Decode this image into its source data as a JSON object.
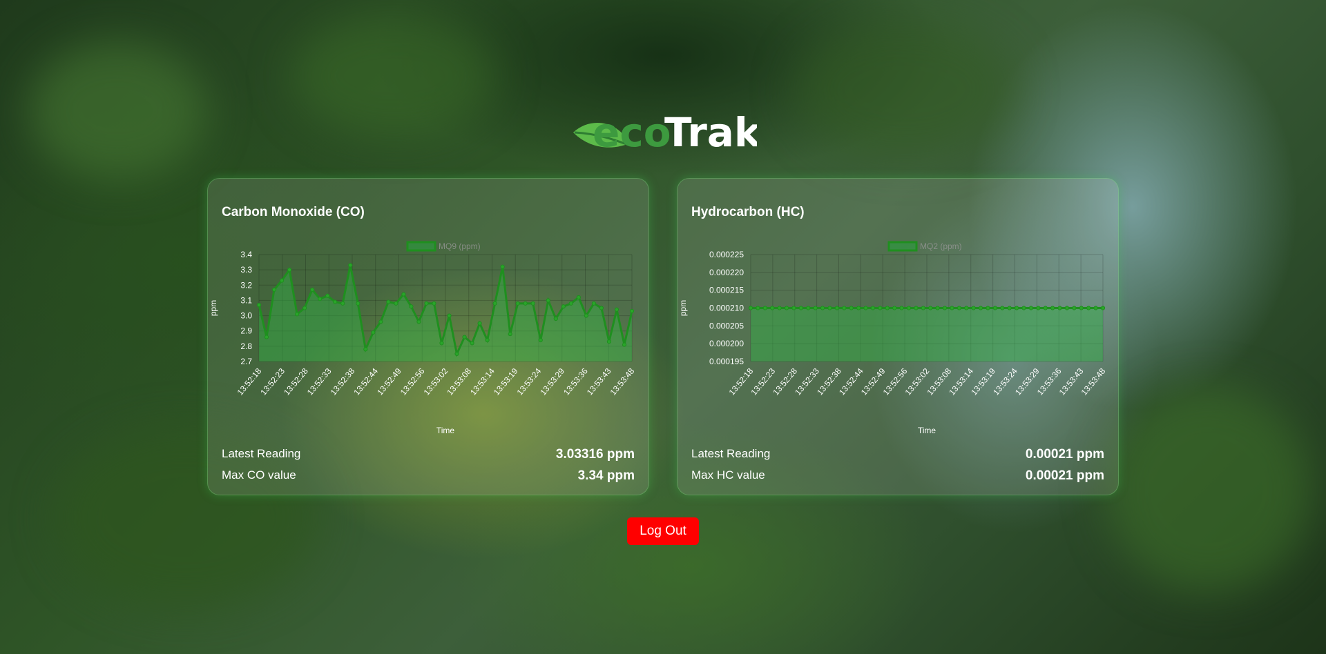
{
  "brand": {
    "eco": "eco",
    "trak": "Trak",
    "leaf_color": "#5dbb4a",
    "eco_color": "#3d9a3f"
  },
  "cards": [
    {
      "title": "Carbon Monoxide (CO)",
      "latest_label": "Latest Reading",
      "latest_value": "3.03316 ppm",
      "max_label": "Max CO value",
      "max_value": "3.34 ppm",
      "chart_data": {
        "type": "area",
        "title": "",
        "legend": "MQ9 (ppm)",
        "legend_position": "top-center",
        "xlabel": "Time",
        "ylabel": "ppm",
        "ylim": [
          2.7,
          3.4
        ],
        "yticks": [
          "3.4",
          "3.3",
          "3.2",
          "3.1",
          "3.0",
          "2.9",
          "2.8",
          "2.7"
        ],
        "grid": true,
        "color": "#1f8f1f",
        "xtick_labels": [
          "13:52:18",
          "13:52:23",
          "13:52:28",
          "13:52:33",
          "13:52:38",
          "13:52:44",
          "13:52:49",
          "13:52:56",
          "13:53:02",
          "13:53:08",
          "13:53:14",
          "13:53:19",
          "13:53:24",
          "13:53:29",
          "13:53:36",
          "13:53:43",
          "13:53:48"
        ],
        "values": [
          3.07,
          2.86,
          3.17,
          3.23,
          3.3,
          3.01,
          3.05,
          3.17,
          3.11,
          3.13,
          3.09,
          3.08,
          3.33,
          3.08,
          2.78,
          2.89,
          2.96,
          3.09,
          3.08,
          3.14,
          3.06,
          2.96,
          3.08,
          3.08,
          2.82,
          3.0,
          2.75,
          2.86,
          2.82,
          2.95,
          2.84,
          3.08,
          3.32,
          2.88,
          3.08,
          3.08,
          3.08,
          2.84,
          3.1,
          2.98,
          3.06,
          3.08,
          3.12,
          3.0,
          3.08,
          3.05,
          2.83,
          3.04,
          2.81,
          3.03
        ]
      }
    },
    {
      "title": "Hydrocarbon (HC)",
      "latest_label": "Latest Reading",
      "latest_value": "0.00021 ppm",
      "max_label": "Max HC value",
      "max_value": "0.00021 ppm",
      "chart_data": {
        "type": "area",
        "title": "",
        "legend": "MQ2 (ppm)",
        "legend_position": "top-center",
        "xlabel": "Time",
        "ylabel": "ppm",
        "ylim": [
          0.000195,
          0.000225
        ],
        "yticks": [
          "0.000225",
          "0.000220",
          "0.000215",
          "0.000210",
          "0.000205",
          "0.000200",
          "0.000195"
        ],
        "grid": true,
        "color": "#1f8f1f",
        "xtick_labels": [
          "13:52:18",
          "13:52:23",
          "13:52:28",
          "13:52:33",
          "13:52:38",
          "13:52:44",
          "13:52:49",
          "13:52:56",
          "13:53:02",
          "13:53:08",
          "13:53:14",
          "13:53:19",
          "13:53:24",
          "13:53:29",
          "13:53:36",
          "13:53:43",
          "13:53:48"
        ],
        "values": [
          0.00021,
          0.00021,
          0.00021,
          0.00021,
          0.00021,
          0.00021,
          0.00021,
          0.00021,
          0.00021,
          0.00021,
          0.00021,
          0.00021,
          0.00021,
          0.00021,
          0.00021,
          0.00021,
          0.00021,
          0.00021,
          0.00021,
          0.00021,
          0.00021,
          0.00021,
          0.00021,
          0.00021,
          0.00021,
          0.00021,
          0.00021,
          0.00021,
          0.00021,
          0.00021,
          0.00021,
          0.00021,
          0.00021,
          0.00021,
          0.00021,
          0.00021,
          0.00021,
          0.00021,
          0.00021,
          0.00021,
          0.00021,
          0.00021,
          0.00021,
          0.00021,
          0.00021,
          0.00021,
          0.00021,
          0.00021,
          0.00021,
          0.00021
        ]
      }
    }
  ],
  "logout_label": "Log Out"
}
